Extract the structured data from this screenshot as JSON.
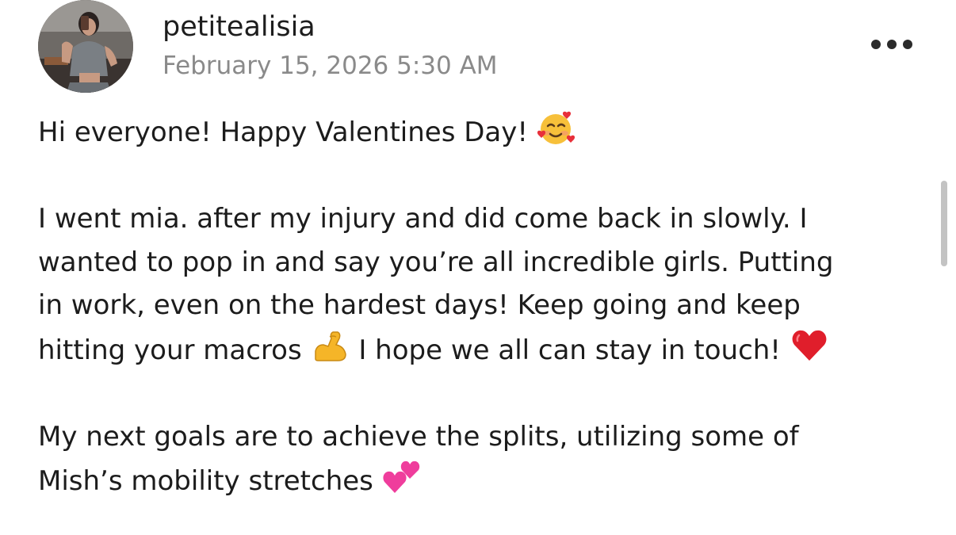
{
  "post": {
    "username": "petitealisia",
    "timestamp": "February 15, 2026 5:30 AM",
    "more_icon": "more-horizontal-icon",
    "lines": [
      {
        "text": "Hi everyone! Happy Valentines Day!",
        "emoji": "smiling-face-with-hearts-icon"
      },
      {
        "text": "I went mia. after my injury and did come back in slowly. I"
      },
      {
        "text": "wanted to pop in and say you’re all incredible girls. Putting"
      },
      {
        "text": "in work, even on the hardest days! Keep going and keep"
      },
      {
        "text_before": "hitting your macros",
        "emoji1": "flexed-biceps-icon",
        "text_after": "I hope we all can stay in touch!",
        "emoji2": "red-heart-icon"
      },
      {
        "text": "My next goals are to achieve the splits, utilizing some of"
      },
      {
        "text": "Mish’s mobility stretches",
        "emoji": "two-hearts-icon"
      }
    ]
  },
  "colors": {
    "text": "#1c1c1c",
    "muted": "#8a8a8a",
    "scrollbar": "#c3c3c3"
  }
}
